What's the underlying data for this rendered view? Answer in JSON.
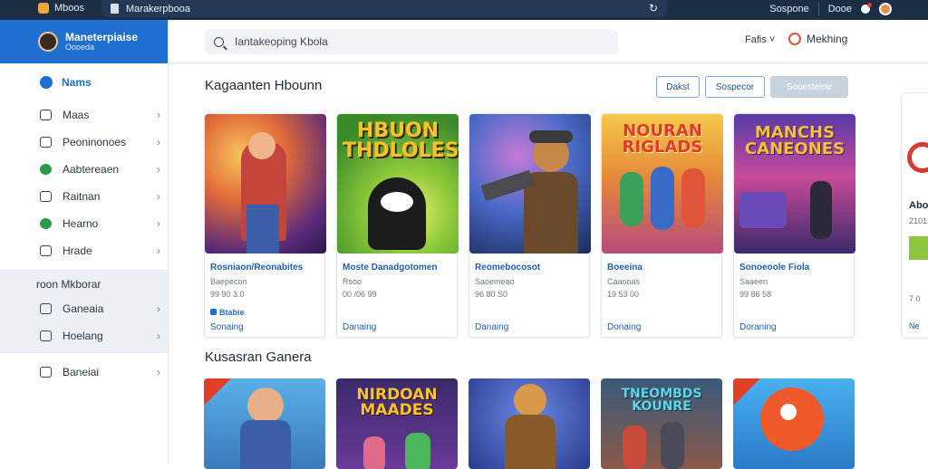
{
  "window": {
    "app_name": "Mboos",
    "url": "Marakerpbooa",
    "right_links": [
      "Sospone",
      "Dooe"
    ]
  },
  "sidebar": {
    "profile_name": "Maneterpiaise",
    "profile_sub": "Oooeda",
    "main_item": "Nams",
    "items": [
      "Maas",
      "Peoninonoes",
      "Aabtereaen",
      "Raitnan",
      "Hearno",
      "Hrade"
    ],
    "group_title": "roon Mkborar",
    "group_items": [
      "Ganeaia",
      "Hoelang"
    ],
    "footer_item": "Baneiai"
  },
  "header": {
    "search_value": "Iantakeoping Kbola",
    "filter_label": "Fafis ˅",
    "cta_label": "Mekhing"
  },
  "section1": {
    "title": "Kagaanten Hbounn",
    "buttons": [
      "Dakst",
      "Sospecor",
      "Sooesteete"
    ]
  },
  "section2": {
    "title": "Kusasran Ganera"
  },
  "cards": [
    {
      "title": "Rosniaon/Reonabites",
      "line1": "Baepecon",
      "line2": "99 90 3.0",
      "badge": "Btabie",
      "action": "Sonaing",
      "art_text": ""
    },
    {
      "title": "Moste Danadgotomen",
      "line1": "Rsoo",
      "line2": "00 /06 99",
      "badge": "",
      "action": "Danaing",
      "art_text": "HBUON THDLOLES"
    },
    {
      "title": "Reomebocosot",
      "line1": "Saoemeao",
      "line2": "96 80 S0",
      "badge": "",
      "action": "Danaing",
      "art_text": ""
    },
    {
      "title": "Boeeina",
      "line1": "Caaooas",
      "line2": "19 53 00",
      "badge": "",
      "action": "Donaing",
      "art_text": "NOURAN RIGLADS"
    },
    {
      "title": "Sonoeoole Fiola",
      "line1": "Saaeen",
      "line2": "99 86 58",
      "badge": "",
      "action": "Doraning",
      "art_text": "MANCHS CANEONES"
    }
  ],
  "cards_row2": [
    {
      "art_text": ""
    },
    {
      "art_text": "NIRDOAN MAADES"
    },
    {
      "art_text": ""
    },
    {
      "art_text": "TNEOMBDS KOUNRE"
    },
    {
      "art_text": ""
    }
  ],
  "side_card": {
    "title": "Abo",
    "line1": "2101",
    "line2": "7 0",
    "line3": "Ne"
  },
  "colors": {
    "accent": "#1f6fd1",
    "topbar": "#1c2e44",
    "link": "#1f5fae"
  }
}
